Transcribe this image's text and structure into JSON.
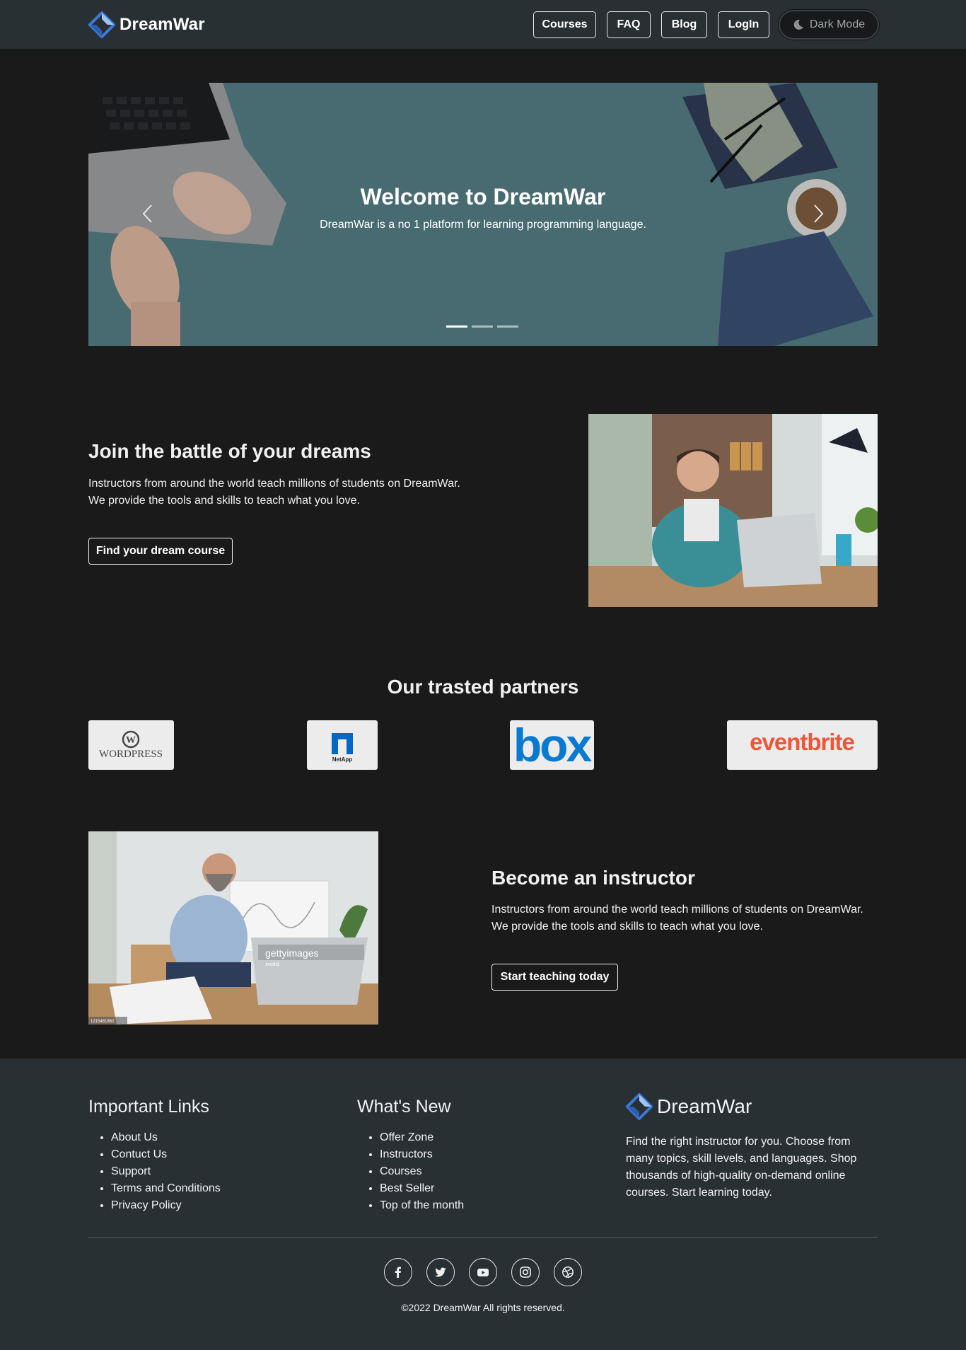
{
  "header": {
    "brand": "DreamWar",
    "nav": [
      "Courses",
      "FAQ",
      "Blog",
      "LogIn"
    ],
    "dark_mode_label": "Dark Mode"
  },
  "hero": {
    "title": "Welcome to DreamWar",
    "subtitle": "DreamWar is a no 1 platform for learning programming language.",
    "slide_count": 3,
    "active_slide": 1
  },
  "join": {
    "title": "Join the battle of your dreams",
    "line1": "Instructors from around the world teach millions of students on DreamWar.",
    "line2": "We provide the tools and skills to teach what you love.",
    "button": "Find your dream course"
  },
  "partners": {
    "title": "Our trasted partners",
    "logos": [
      "WordPress",
      "NetApp",
      "box",
      "eventbrite"
    ]
  },
  "instructor": {
    "title": "Become an instructor",
    "line1": "Instructors from around the world teach millions of students on DreamWar.",
    "line2": "We provide the tools and skills to teach what you love.",
    "button": "Start teaching today",
    "image_watermark": "gettyimages",
    "image_credit": "zvotild",
    "image_id": "1215481862"
  },
  "footer": {
    "important_links_title": "Important Links",
    "important_links": [
      "About Us",
      "Contuct Us",
      "Support",
      "Terms and Conditions",
      "Privacy Policy"
    ],
    "whats_new_title": "What's New",
    "whats_new": [
      "Offer Zone",
      "Instructors",
      "Courses",
      "Best Seller",
      "Top of the month"
    ],
    "brand": "DreamWar",
    "description": "Find the right instructor for you. Choose from many topics, skill levels, and languages. Shop thousands of high-quality on-demand online courses. Start learning today.",
    "socials": [
      "facebook-icon",
      "twitter-icon",
      "youtube-icon",
      "instagram-icon",
      "dribbble-icon"
    ],
    "copyright": "©2022 DreamWar All rights reserved."
  },
  "colors": {
    "page_bg": "#1a1a1b",
    "header_bg": "#293034",
    "footer_bg": "#293034",
    "brand_blue": "#4a90e2"
  }
}
